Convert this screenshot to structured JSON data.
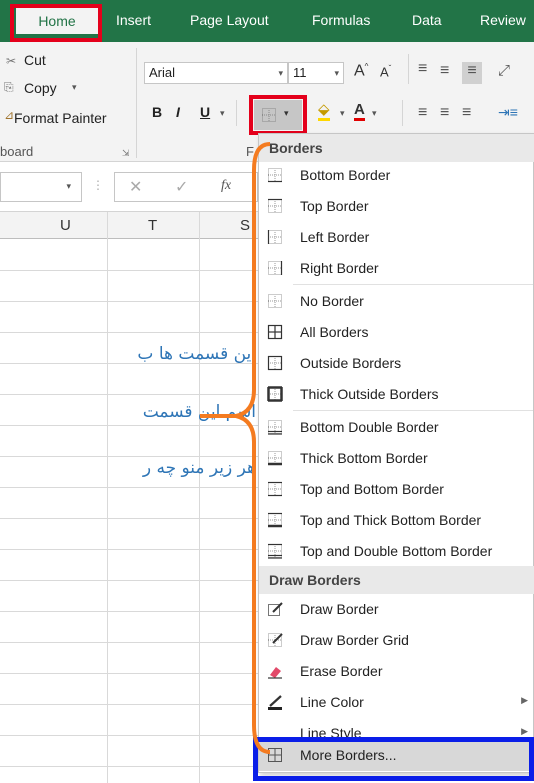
{
  "tabs": {
    "home": "Home",
    "insert": "Insert",
    "page_layout": "Page Layout",
    "formulas": "Formulas",
    "data": "Data",
    "review": "Review"
  },
  "ribbon": {
    "cut": "Cut",
    "copy": "Copy",
    "format_painter": "Format Painter",
    "clipboard_group": "board",
    "font_name": "Arial",
    "font_size": "11",
    "bold": "B",
    "italic": "I",
    "underline": "U",
    "font_group_initial": "F"
  },
  "formula_bar": {
    "fx": "fx"
  },
  "columns": [
    "U",
    "T",
    "S"
  ],
  "annotation": {
    "line1": "این قسمت ها ب",
    "line2": "اسم این قسمت",
    "line3": "هر زیر منو چه ر"
  },
  "menu": {
    "header_borders": "Borders",
    "header_draw": "Draw Borders",
    "items": [
      {
        "label": "Bottom Border",
        "icon": "bottom-border-icon"
      },
      {
        "label": "Top Border",
        "icon": "top-border-icon"
      },
      {
        "label": "Left Border",
        "icon": "left-border-icon"
      },
      {
        "label": "Right Border",
        "icon": "right-border-icon"
      },
      {
        "label": "No Border",
        "icon": "no-border-icon"
      },
      {
        "label": "All Borders",
        "icon": "all-borders-icon"
      },
      {
        "label": "Outside Borders",
        "icon": "outside-borders-icon"
      },
      {
        "label": "Thick Outside Borders",
        "icon": "thick-outside-borders-icon"
      },
      {
        "label": "Bottom Double Border",
        "icon": "bottom-double-border-icon"
      },
      {
        "label": "Thick Bottom Border",
        "icon": "thick-bottom-border-icon"
      },
      {
        "label": "Top and Bottom Border",
        "icon": "top-and-bottom-border-icon"
      },
      {
        "label": "Top and Thick Bottom Border",
        "icon": "top-and-thick-bottom-border-icon"
      },
      {
        "label": "Top and Double Bottom Border",
        "icon": "top-and-double-bottom-border-icon"
      }
    ],
    "draw_items": [
      {
        "label": "Draw Border",
        "icon": "draw-border-icon"
      },
      {
        "label": "Draw Border Grid",
        "icon": "draw-border-grid-icon"
      },
      {
        "label": "Erase Border",
        "icon": "eraser-icon"
      },
      {
        "label": "Line Color",
        "icon": "line-color-icon"
      },
      {
        "label": "Line Style",
        "icon": ""
      }
    ],
    "more_borders": "More Borders..."
  },
  "colors": {
    "ribbon_green": "#227447",
    "highlight_red": "#e4001b",
    "brace_orange": "#f47b20",
    "highlight_blue": "#0a1ee8",
    "annotation_blue": "#2e75b6"
  }
}
